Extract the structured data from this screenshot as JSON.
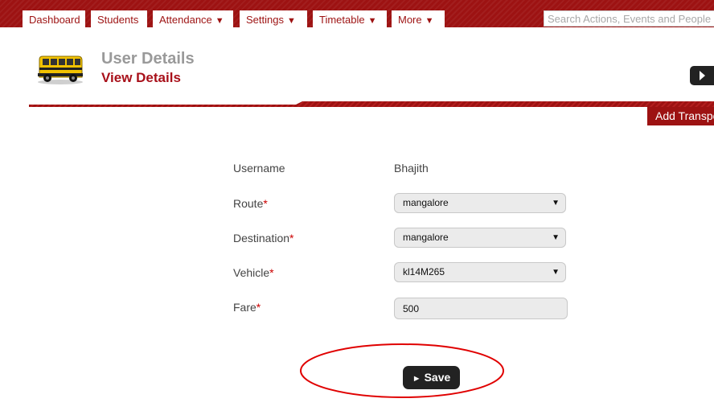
{
  "nav": {
    "tabs": [
      {
        "label": "Dashboard",
        "dropdown": ""
      },
      {
        "label": "Students",
        "dropdown": ""
      },
      {
        "label": "Attendance",
        "dropdown": "▼"
      },
      {
        "label": "Settings",
        "dropdown": "▼"
      },
      {
        "label": "Timetable",
        "dropdown": "▼"
      },
      {
        "label": "More",
        "dropdown": "▼"
      }
    ],
    "search_placeholder": "Search Actions, Events and People"
  },
  "header": {
    "title": "User Details",
    "subtitle": "View Details",
    "icon": "school-bus-icon",
    "add_tab_label": "Add Transport"
  },
  "form": {
    "username": {
      "label": "Username",
      "value": "Bhajith"
    },
    "route": {
      "label": "Route",
      "required": "*",
      "value": "mangalore"
    },
    "destination": {
      "label": "Destination",
      "required": "*",
      "value": "mangalore"
    },
    "vehicle": {
      "label": "Vehicle",
      "required": "*",
      "value": "kl14M265"
    },
    "fare": {
      "label": "Fare",
      "required": "*",
      "value": "500"
    },
    "save_label": "Save"
  },
  "colors": {
    "brand": "#9d1212",
    "subtitle": "#a8101a",
    "title": "#9a9a9a",
    "annotation": "#e00000"
  }
}
